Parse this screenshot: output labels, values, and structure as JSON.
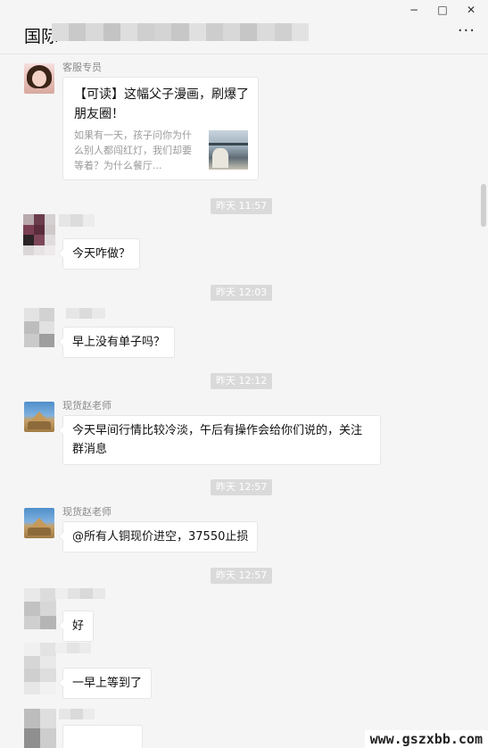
{
  "window": {
    "title_visible": "国际",
    "minimize": "−",
    "maximize": "□",
    "close": "✕",
    "more": "···"
  },
  "messages": {
    "card": {
      "sender": "客服专员",
      "title": "【可读】这幅父子漫画，刷爆了朋友圈！",
      "desc": "如果有一天，孩子问你为什么别人都闯红灯，我们却要等着？为什么餐厅..."
    },
    "ts1": "昨天 11:57",
    "m1": "今天咋做？",
    "ts2": "昨天 12:03",
    "m2": "早上没有单子吗？",
    "ts3": "昨天 12:12",
    "m3_sender": "现货赵老师",
    "m3": "今天早间行情比较冷淡，午后有操作会给你们说的，关注群消息",
    "ts4": "昨天 12:57",
    "m4_sender": "现货赵老师",
    "m4": "@所有人铜现价进空，37550止损",
    "ts5": "昨天 12:57",
    "m5": "好",
    "m6": "一早上等到了"
  },
  "watermark": "www.gszxbb.com",
  "colors": {
    "background": "#f5f5f5",
    "bubble": "#ffffff",
    "timestamp_bg": "#dadada",
    "sender_text": "#8a8a8a"
  }
}
